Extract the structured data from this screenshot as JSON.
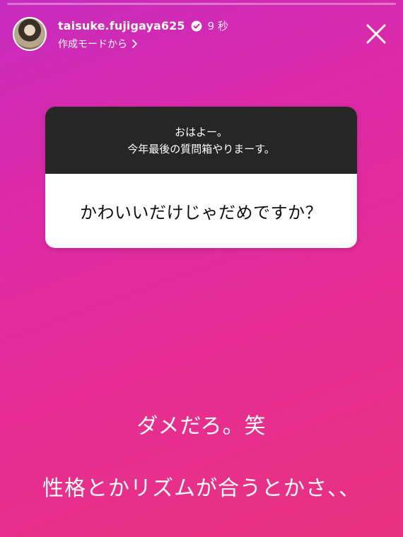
{
  "story": {
    "progress": 0
  },
  "header": {
    "username": "taisuke.fujigaya625",
    "time": "9 秒",
    "source": "作成モードから",
    "verified_icon": "verified-badge-icon",
    "close_icon": "close-icon"
  },
  "question_box": {
    "header_line1": "おはよー。",
    "header_line2": "今年最後の質問箱やりまーす。",
    "question": "かわいいだけじゃだめですか？"
  },
  "answer": {
    "line1": "ダメだろ。笑",
    "line2": "性格とかリズムが合うとかさ、、"
  },
  "colors": {
    "gradient_start": "#c72bbf",
    "gradient_end": "#e8337f",
    "box_header": "#262626",
    "box_body": "#ffffff"
  }
}
